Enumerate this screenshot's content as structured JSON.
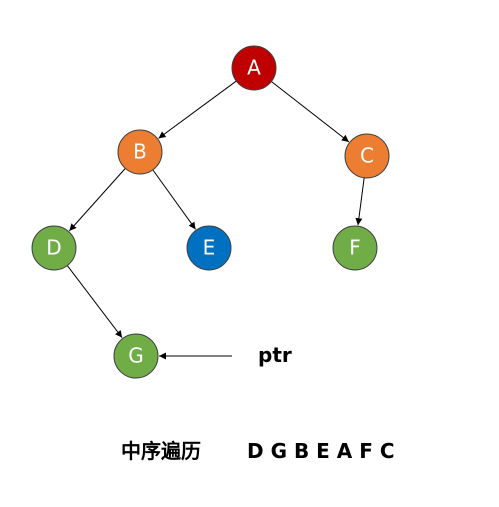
{
  "nodes": [
    {
      "id": "A",
      "label": "A",
      "fill": "#C00000"
    },
    {
      "id": "B",
      "label": "B",
      "fill": "#ED7D31"
    },
    {
      "id": "C",
      "label": "C",
      "fill": "#ED7D31"
    },
    {
      "id": "D",
      "label": "D",
      "fill": "#70AD47"
    },
    {
      "id": "E",
      "label": "E",
      "fill": "#0070C0"
    },
    {
      "id": "F",
      "label": "F",
      "fill": "#70AD47"
    },
    {
      "id": "G",
      "label": "G",
      "fill": "#70AD47"
    }
  ],
  "edges": [
    {
      "from": "A",
      "to": "B"
    },
    {
      "from": "A",
      "to": "C"
    },
    {
      "from": "B",
      "to": "D"
    },
    {
      "from": "B",
      "to": "E"
    },
    {
      "from": "C",
      "to": "F"
    },
    {
      "from": "D",
      "to": "G"
    }
  ],
  "pointer": {
    "label": "ptr",
    "target": "G"
  },
  "caption": {
    "title": "中序遍历",
    "sequence": "D G B E A F C"
  },
  "colors": {
    "node_stroke": "#404040",
    "edge": "#000000"
  }
}
